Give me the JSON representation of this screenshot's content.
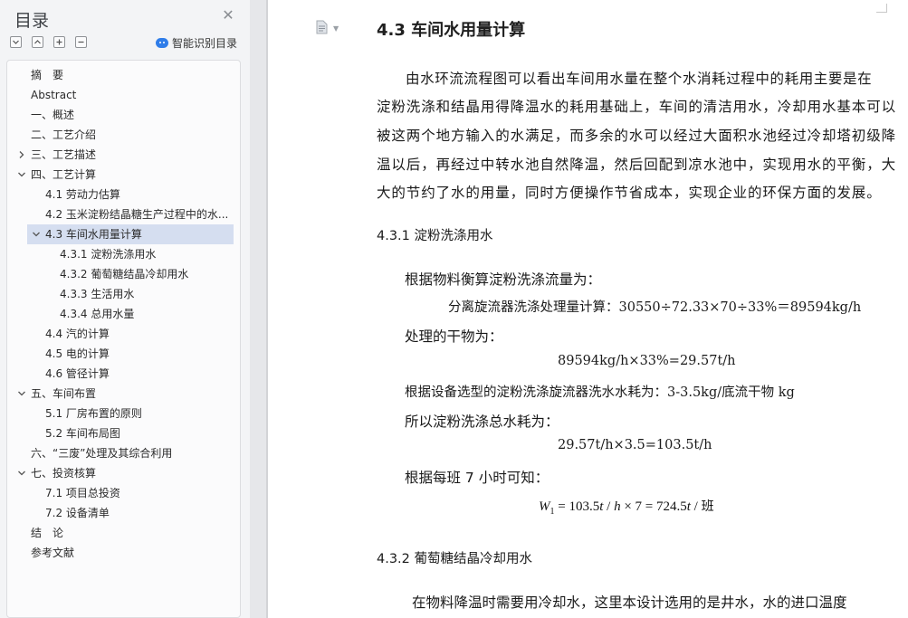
{
  "sidebar": {
    "title": "目录",
    "close_icon": "close-icon",
    "tools": [
      "expand-all-icon",
      "collapse-all-icon",
      "add-icon",
      "remove-icon"
    ],
    "smart_label": "智能识别目录",
    "items": [
      {
        "label": "摘　要",
        "level": 1,
        "arrow": ""
      },
      {
        "label": "Abstract",
        "level": 1,
        "arrow": ""
      },
      {
        "label": "一、概述",
        "level": 1,
        "arrow": ""
      },
      {
        "label": "二、工艺介绍",
        "level": 1,
        "arrow": ""
      },
      {
        "label": "三、工艺描述",
        "level": 1,
        "arrow": "right"
      },
      {
        "label": "四、工艺计算",
        "level": 1,
        "arrow": "down"
      },
      {
        "label": "4.1 劳动力估算",
        "level": 2,
        "arrow": ""
      },
      {
        "label": "4.2 玉米淀粉结晶糖生产过程中的水...",
        "level": 2,
        "arrow": ""
      },
      {
        "label": "4.3 车间水用量计算",
        "level": 2,
        "arrow": "down",
        "active": true
      },
      {
        "label": "4.3.1 淀粉洗涤用水",
        "level": 3,
        "arrow": ""
      },
      {
        "label": "4.3.2  葡萄糖结晶冷却用水",
        "level": 3,
        "arrow": ""
      },
      {
        "label": "4.3.3  生活用水",
        "level": 3,
        "arrow": ""
      },
      {
        "label": "4.3.4  总用水量",
        "level": 3,
        "arrow": ""
      },
      {
        "label": "4.4  汽的计算",
        "level": 2,
        "arrow": ""
      },
      {
        "label": "4.5  电的计算",
        "level": 2,
        "arrow": ""
      },
      {
        "label": "4.6  管径计算",
        "level": 2,
        "arrow": ""
      },
      {
        "label": "五、车间布置",
        "level": 1,
        "arrow": "down"
      },
      {
        "label": "5.1 厂房布置的原则",
        "level": 2,
        "arrow": ""
      },
      {
        "label": "5.2 车间布局图",
        "level": 2,
        "arrow": ""
      },
      {
        "label": "六、“三废”处理及其综合利用",
        "level": 1,
        "arrow": ""
      },
      {
        "label": "七、投资核算",
        "level": 1,
        "arrow": "down"
      },
      {
        "label": "7.1 项目总投资",
        "level": 2,
        "arrow": ""
      },
      {
        "label": "7.2 设备清单",
        "level": 2,
        "arrow": ""
      },
      {
        "label": "结　论",
        "level": 1,
        "arrow": ""
      },
      {
        "label": "参考文献",
        "level": 1,
        "arrow": ""
      }
    ]
  },
  "document": {
    "heading": "4.3 车间水用量计算",
    "para_lines": [
      "由水环流流程图可以看出车间用水量在整个水消耗过程中的耗用主要是在",
      "淀粉洗涤和结晶用得降温水的耗用基础上，车间的清洁用水，冷却用水基本可以",
      "被这两个地方输入的水满足，而多余的水可以经过大面积水池经过冷却塔初级降",
      "温以后，再经过中转水池自然降温，然后回配到凉水池中，实现用水的平衡，大",
      "大的节约了水的用量，同时方便操作节省成本，实现企业的环保方面的发展。"
    ],
    "sub1_heading": "4.3.1 淀粉洗涤用水",
    "line_a": "根据物料衡算淀粉洗涤流量为：",
    "line_b": "分离旋流器洗涤处理量计算：30550÷72.33×70÷33%＝89594kg/h",
    "line_c": "处理的干物为：",
    "line_d": "89594kg/h×33%=29.57t/h",
    "line_e": "根据设备选型的淀粉洗涤旋流器洗水水耗为：3-3.5kg/底流干物 kg",
    "line_f": "所以淀粉洗涤总水耗为：",
    "line_g": "29.57t/h×3.5=103.5t/h",
    "line_h": "根据每班 7 小时可知：",
    "formula": {
      "var": "W",
      "sub": "1",
      "rest": " = 103.5",
      "t1": "t",
      "slash1": " / ",
      "h": "h",
      "times": " × 7 = 724.5",
      "t2": "t",
      "slash2": " / ",
      "unit": "班"
    },
    "sub2_heading": "4.3.2  葡萄糖结晶冷却用水",
    "line_i": "在物料降温时需要用冷却水，这里本设计选用的是井水，水的进口温度"
  }
}
